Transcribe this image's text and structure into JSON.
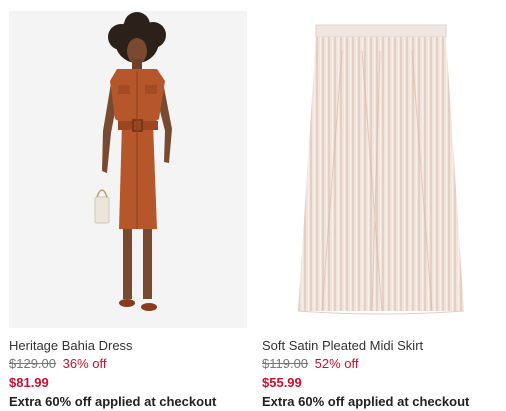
{
  "products": [
    {
      "name": "Heritage Bahia Dress",
      "original_price": "$129.00",
      "discount": "36% off",
      "sale_price": "$81.99",
      "promo": "Extra 60% off applied at checkout",
      "image": "model-in-rust-shirt-dress"
    },
    {
      "name": "Soft Satin Pleated Midi Skirt",
      "original_price": "$119.00",
      "discount": "52% off",
      "sale_price": "$55.99",
      "promo": "Extra 60% off applied at checkout",
      "image": "pleated-midi-skirt"
    }
  ],
  "colors": {
    "sale": "#c8102e",
    "dress": "#b5562b",
    "image_bg": "#f4f4f4"
  }
}
